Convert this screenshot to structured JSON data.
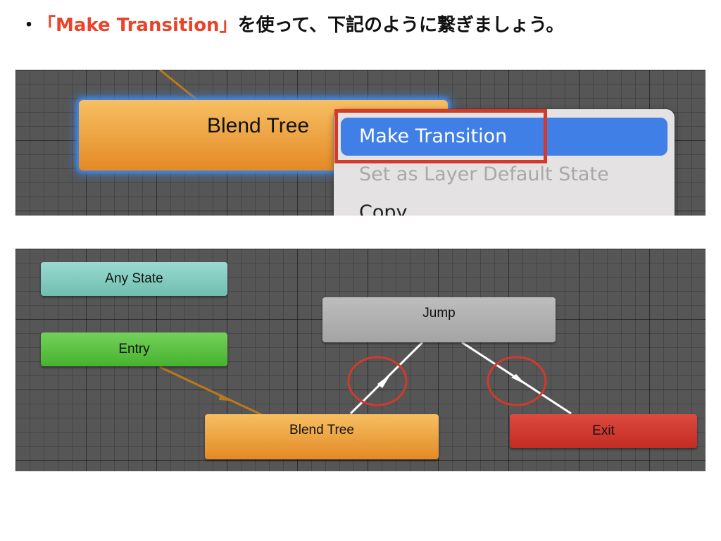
{
  "instruction": {
    "bullet": "・",
    "highlight": "「Make Transition」",
    "rest": "を使って、下記のように繋ぎましょう。"
  },
  "top_panel": {
    "state_label": "Blend Tree",
    "menu": {
      "items": [
        {
          "label": "Make Transition",
          "state": "highlighted"
        },
        {
          "label": "Set as Layer Default State",
          "state": "disabled"
        },
        {
          "label": "Copy",
          "state": "normal"
        }
      ]
    }
  },
  "bottom_panel": {
    "states": {
      "any_state": "Any State",
      "entry": "Entry",
      "jump": "Jump",
      "blend_tree": "Blend Tree",
      "exit": "Exit"
    }
  },
  "colors": {
    "highlight_text": "#e9432a",
    "annotation_red": "#d23a2b",
    "menu_selected": "#3f7fe6",
    "grid_bg": "#565656",
    "state_orange": "#e48a25",
    "state_green": "#47b22f",
    "state_cyan": "#6fbfb1",
    "state_gray": "#a4a4a4",
    "state_red": "#c22c22",
    "default_transition": "#b97a1c",
    "transition_white": "#ffffff"
  }
}
